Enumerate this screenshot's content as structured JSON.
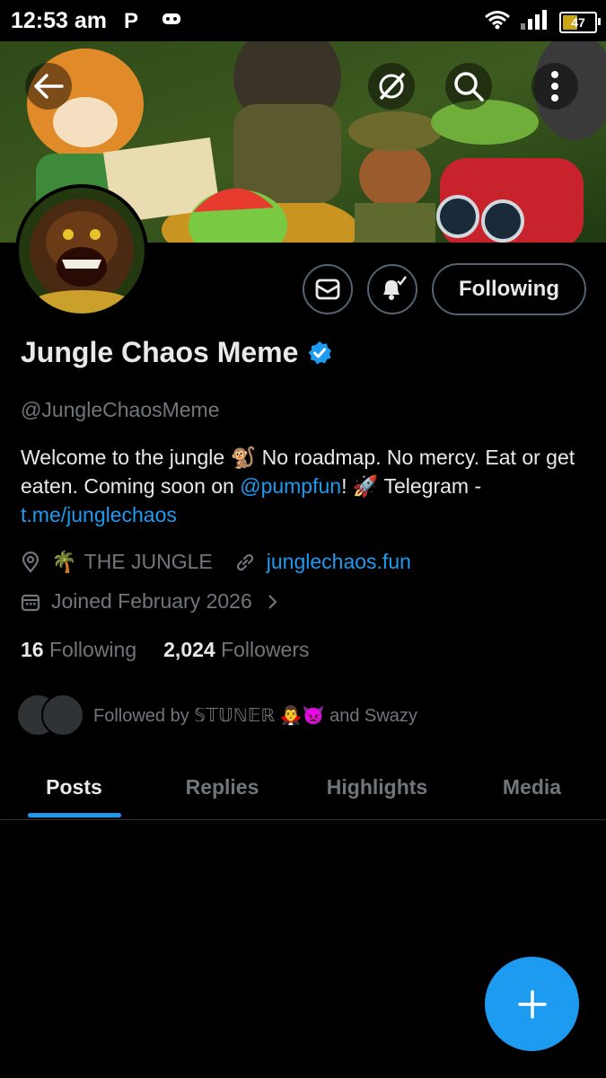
{
  "status_bar": {
    "time": "12:53 am",
    "app_letter": "P",
    "battery": "47"
  },
  "profile": {
    "display_name": "Jungle Chaos Meme",
    "handle": "@JungleChaosMeme",
    "bio_part1": "Welcome to the jungle ",
    "bio_emoji1": "🐒",
    "bio_part2": " No roadmap. No mercy. Eat or get eaten. Coming soon on ",
    "bio_mention": "@pumpfun",
    "bio_part3": "! ",
    "bio_emoji2": "🚀",
    "bio_part4": "  Telegram - ",
    "bio_link": "t.me/junglechaos",
    "location_emoji": "🌴",
    "location": "THE JUNGLE",
    "website": "junglechaos.fun",
    "joined": "Joined February 2026",
    "following_count": "16",
    "following_label": "Following",
    "followers_count": "2,024",
    "followers_label": "Followers",
    "followed_by": "Followed by 𝕊𝕋𝕌ℕ𝔼ℝ 🧛‍♂️👿 and Swazy"
  },
  "actions": {
    "following_button": "Following"
  },
  "tabs": [
    {
      "label": "Posts",
      "active": true
    },
    {
      "label": "Replies",
      "active": false
    },
    {
      "label": "Highlights",
      "active": false
    },
    {
      "label": "Media",
      "active": false
    }
  ],
  "colors": {
    "accent": "#1d9bf0",
    "muted": "#71767b",
    "border": "#536471",
    "background": "#000000"
  }
}
